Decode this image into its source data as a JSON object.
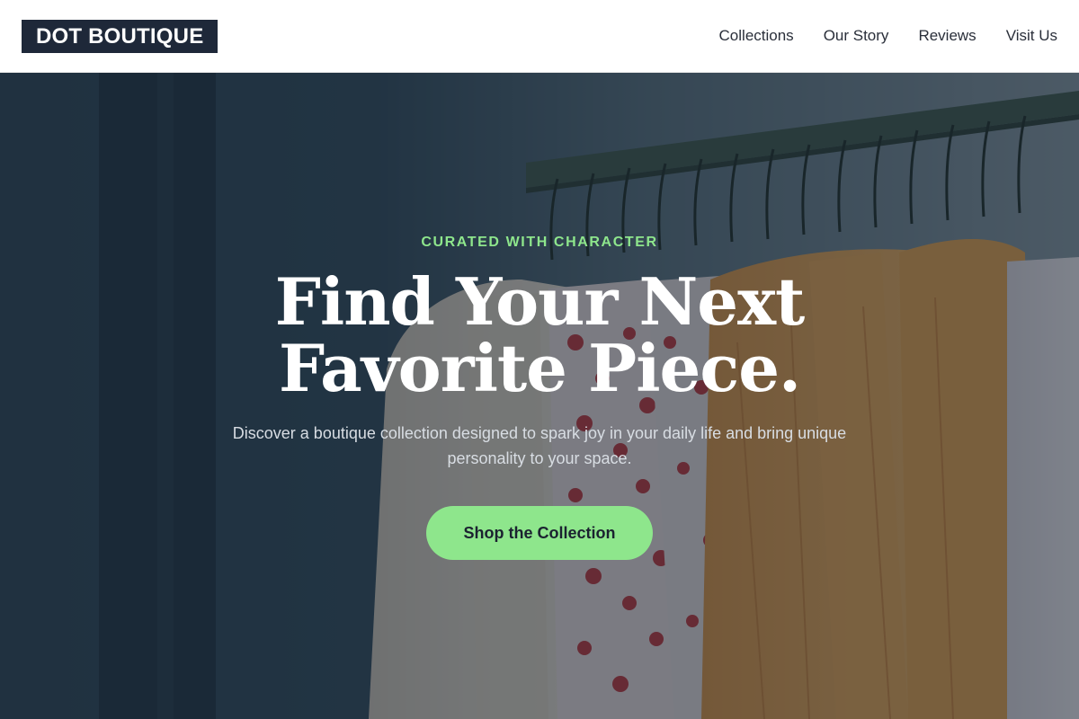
{
  "brand": {
    "name": "DOT BOUTIQUE"
  },
  "nav": {
    "items": [
      {
        "label": "Collections"
      },
      {
        "label": "Our Story"
      },
      {
        "label": "Reviews"
      },
      {
        "label": "Visit Us"
      }
    ]
  },
  "hero": {
    "eyebrow": "CURATED WITH CHARACTER",
    "headline": "Find Your Next Favorite Piece.",
    "subtext": "Discover a boutique collection designed to spark joy in your daily life and bring unique personality to your space.",
    "cta_label": "Shop the Collection",
    "background_image": "clothing-rack-photo"
  },
  "colors": {
    "brand_dark": "#1e2839",
    "accent_green": "#8ee68c",
    "nav_text": "#2a2f3a"
  }
}
